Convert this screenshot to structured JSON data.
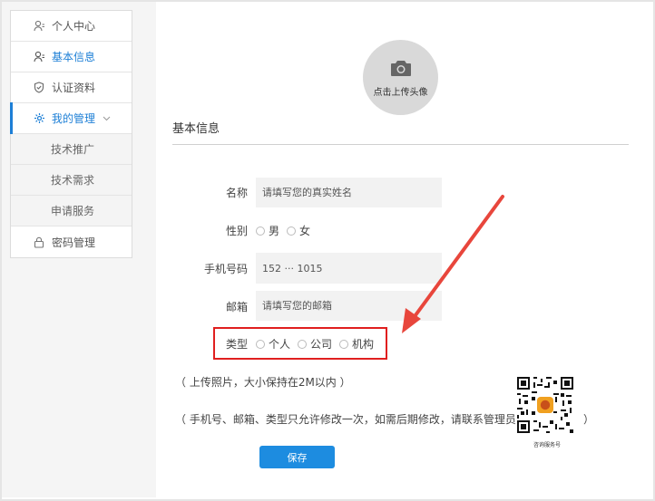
{
  "sidebar": {
    "items": [
      {
        "label": "个人中心",
        "icon": "user-icon"
      },
      {
        "label": "基本信息",
        "icon": "user-icon"
      },
      {
        "label": "认证资料",
        "icon": "shield-icon"
      },
      {
        "label": "我的管理",
        "icon": "gear-icon"
      },
      {
        "label": "技术推广"
      },
      {
        "label": "技术需求"
      },
      {
        "label": "申请服务"
      },
      {
        "label": "密码管理",
        "icon": "lock-icon"
      }
    ]
  },
  "avatar": {
    "label": "点击上传头像"
  },
  "section_title": "基本信息",
  "form": {
    "name": {
      "label": "名称",
      "placeholder": "请填写您的真实姓名"
    },
    "gender": {
      "label": "性别",
      "options": [
        "男",
        "女"
      ]
    },
    "phone": {
      "label": "手机号码",
      "value": "152 ··· 1015"
    },
    "email": {
      "label": "邮箱",
      "placeholder": "请填写您的邮箱"
    },
    "type": {
      "label": "类型",
      "options": [
        "个人",
        "公司",
        "机构"
      ]
    }
  },
  "notes": {
    "photo": "（ 上传照片，大小保持在2M以内 ）",
    "contact": "（ 手机号、邮箱、类型只允许修改一次，如需后期修改，请联系管理员：",
    "contact_close": "）"
  },
  "qr_caption": "咨询服务号",
  "save_label": "保存",
  "colors": {
    "accent": "#1d8ce0",
    "highlight": "#e01f1f",
    "arrow": "#e8463c"
  }
}
